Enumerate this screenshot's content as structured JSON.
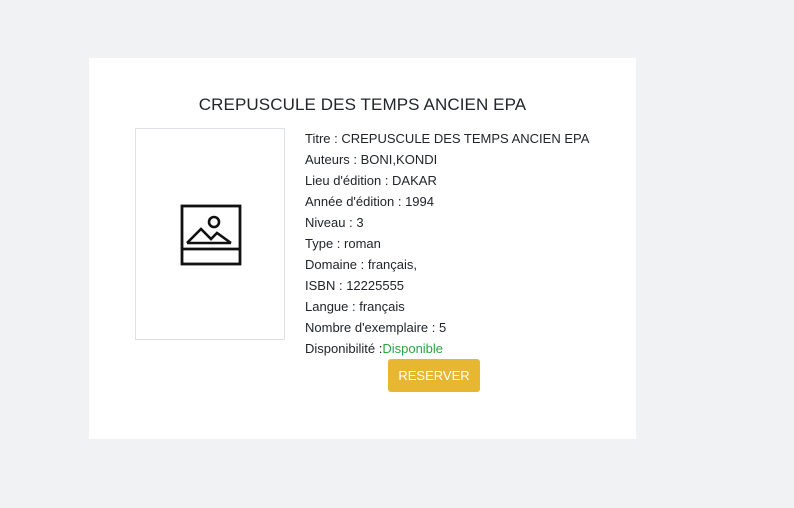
{
  "book": {
    "heading": "CREPUSCULE DES TEMPS ANCIEN EPA",
    "image_icon": "image-placeholder-icon",
    "fields": [
      {
        "label": "Titre : ",
        "value": "CREPUSCULE DES TEMPS ANCIEN EPA"
      },
      {
        "label": "Auteurs : ",
        "value": "BONI,KONDI"
      },
      {
        "label": "Lieu d'édition : ",
        "value": "DAKAR"
      },
      {
        "label": "Année d'édition : ",
        "value": "1994"
      },
      {
        "label": "Niveau : ",
        "value": "3"
      },
      {
        "label": "Type : ",
        "value": "roman"
      },
      {
        "label": "Domaine : ",
        "value": "français,"
      },
      {
        "label": "ISBN : ",
        "value": "12225555"
      },
      {
        "label": "Langue : ",
        "value": "français"
      },
      {
        "label": "Nombre d'exemplaire : ",
        "value": "5"
      }
    ],
    "availability": {
      "label": "Disponibilité :",
      "value": "Disponible",
      "color": "#28a745"
    }
  },
  "actions": {
    "reserve_label": "RESERVER",
    "reserve_color": "#e7b731"
  },
  "colors": {
    "page_background": "#f1f2f4",
    "card_background": "#ffffff"
  }
}
